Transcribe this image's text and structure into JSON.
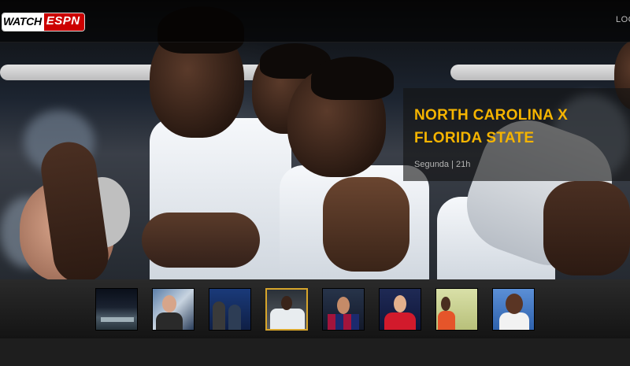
{
  "header": {
    "logo_watch": "WATCH",
    "logo_espn": "ESPN",
    "login_label": "LOGIN"
  },
  "featured": {
    "title": "NORTH CAROLINA X FLORIDA STATE",
    "subtitle": "Segunda | 21h"
  },
  "carousel": {
    "items": [
      {
        "name": "stadium"
      },
      {
        "name": "studio-anchor"
      },
      {
        "name": "studio-panel"
      },
      {
        "name": "basketball-bench",
        "active": true
      },
      {
        "name": "soccer-player-barcelona"
      },
      {
        "name": "soccer-player-bayern"
      },
      {
        "name": "athlete-orange"
      },
      {
        "name": "basketball-rockets"
      }
    ]
  },
  "colors": {
    "accent": "#f5b400",
    "espn_red": "#cc0000",
    "active_border": "#d7a52b"
  }
}
